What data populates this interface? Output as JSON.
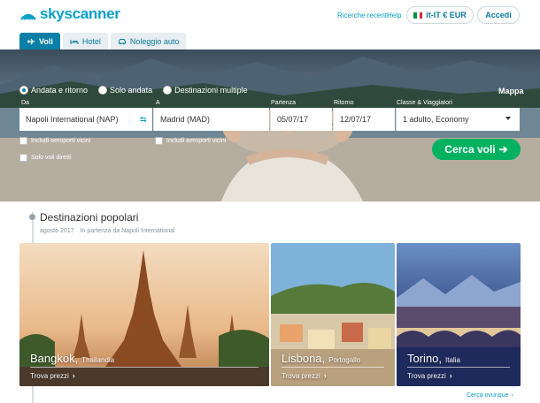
{
  "header": {
    "logo_text": "skyscanner",
    "recent_searches": "Ricerche recenti",
    "help": "Help",
    "locale": "it-IT € EUR",
    "login": "Accedi"
  },
  "tabs": [
    {
      "label": "Voli",
      "icon": "plane-icon",
      "active": true
    },
    {
      "label": "Hotel",
      "icon": "bed-icon",
      "active": false
    },
    {
      "label": "Noleggio auto",
      "icon": "car-icon",
      "active": false
    }
  ],
  "search": {
    "trip_types": [
      {
        "label": "Andata e ritorno",
        "selected": true
      },
      {
        "label": "Solo andata",
        "selected": false
      },
      {
        "label": "Destinazioni multiple",
        "selected": false
      }
    ],
    "map_link": "Mappa",
    "from_label": "Da",
    "from_value": "Napoli International (NAP)",
    "to_label": "A",
    "to_value": "Madrid (MAD)",
    "depart_label": "Partenza",
    "depart_value": "05/07/17",
    "return_label": "Ritorno",
    "return_value": "12/07/17",
    "class_label": "Classe & Viaggiatori",
    "class_value": "1 adulto, Economy",
    "nearby_from": "Includi aeroporti vicini",
    "nearby_to": "Includi aeroporti vicini",
    "direct_only": "Solo voli diretti",
    "submit": "Cerca voli",
    "submit_arrow": "➔"
  },
  "popular": {
    "title": "Destinazioni popolari",
    "month": "agosto 2017",
    "origin": "In partenza da Napoli International",
    "cards": [
      {
        "city": "Bangkok,",
        "country": "Thailandia",
        "cta": "Trova prezzi",
        "arrow": "›"
      },
      {
        "city": "Lisbona,",
        "country": "Portogallo",
        "cta": "Trova prezzi",
        "arrow": "›"
      },
      {
        "city": "Torino,",
        "country": "Italia",
        "cta": "Trova prezzi",
        "arrow": "›"
      }
    ],
    "more": "Cerca ovunque",
    "more_arrow": "›"
  },
  "colors": {
    "brand": "#0aa0c8",
    "tab_active": "#0c7fa8",
    "search_button": "#00b160"
  }
}
